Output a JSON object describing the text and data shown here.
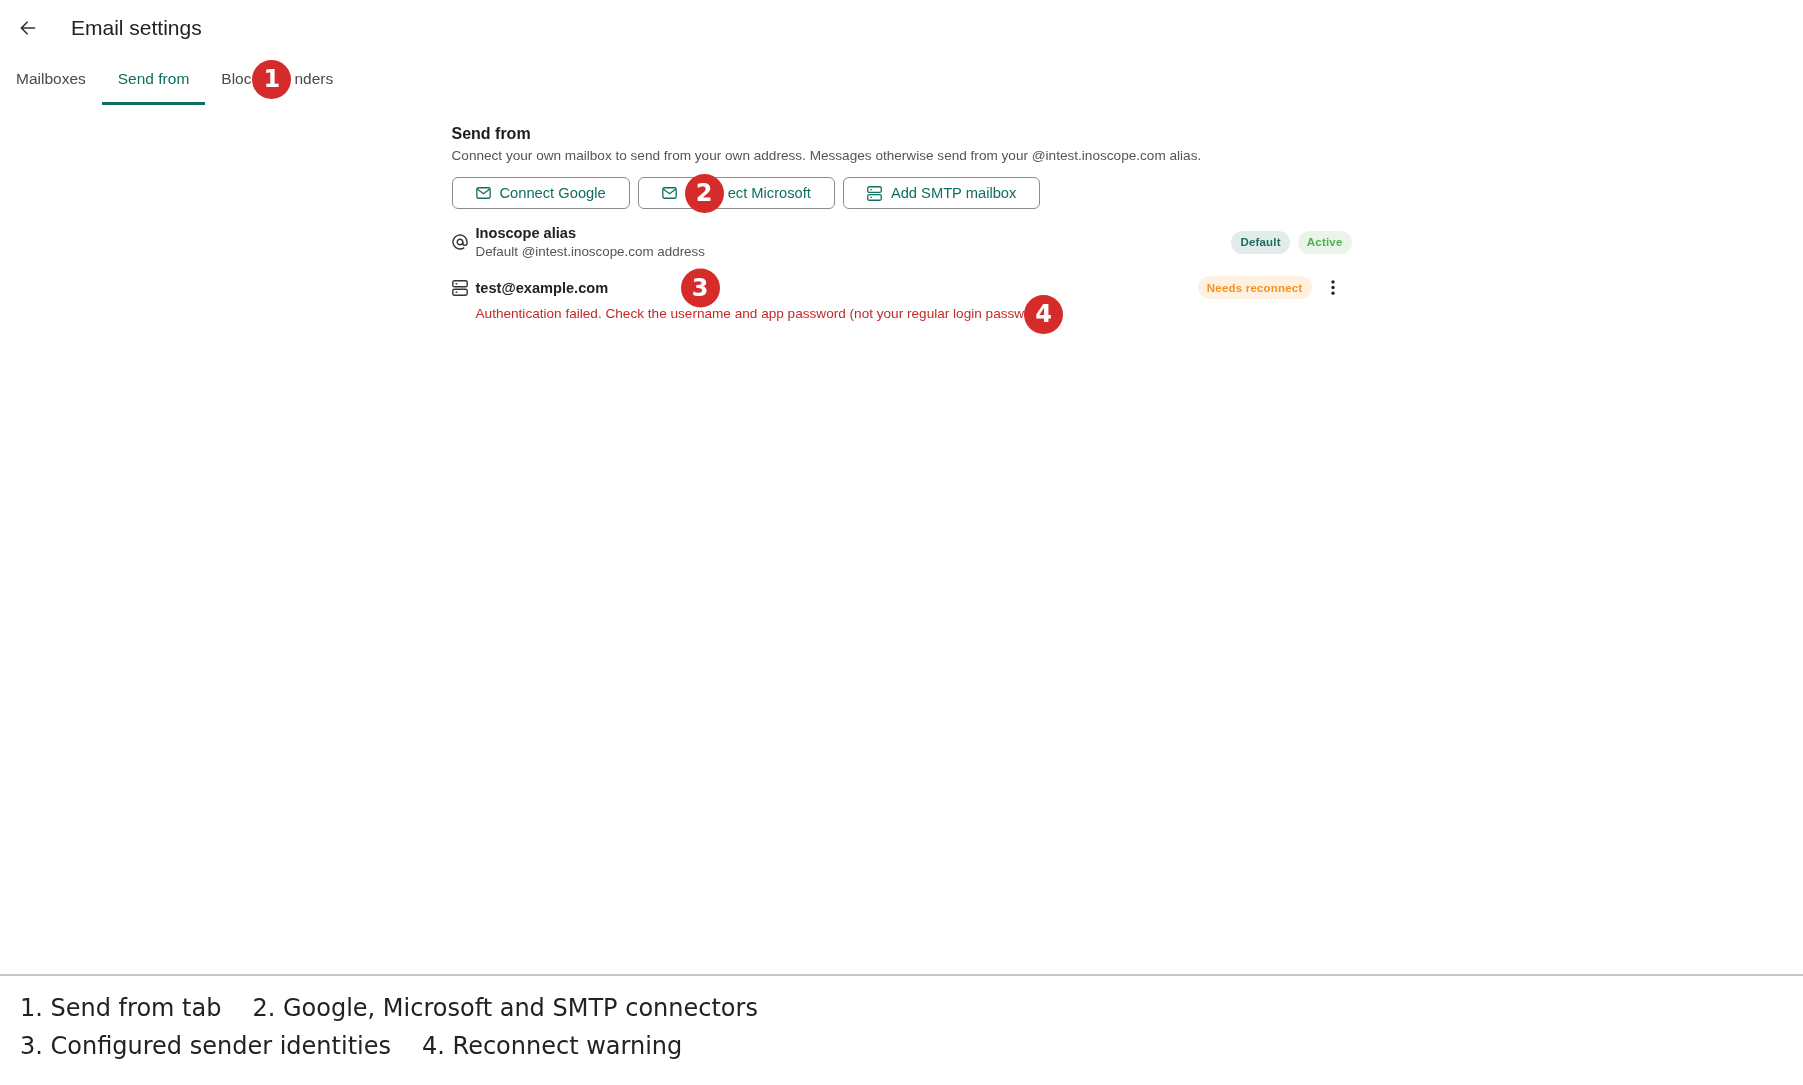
{
  "header": {
    "title": "Email settings"
  },
  "tabs": [
    {
      "label": "Mailboxes",
      "selected": false
    },
    {
      "label": "Send from",
      "selected": true
    },
    {
      "label": "Bloc",
      "marker": "1",
      "label_after": "nders",
      "selected": false
    }
  ],
  "section": {
    "heading": "Send from",
    "description": "Connect your own mailbox to send from your own address. Messages otherwise send from your @intest.inoscope.com alias.",
    "buttons": [
      {
        "label": "Connect Google"
      },
      {
        "marker": "2",
        "label": "ect Microsoft"
      },
      {
        "label": "Add SMTP mailbox"
      }
    ],
    "senders": [
      {
        "name": "Inoscope alias",
        "description": "Default @intest.inoscope.com address",
        "badges": [
          {
            "label": "Default",
            "color": "#1e6b5c"
          },
          {
            "label": "Active",
            "color": "#4caf50"
          }
        ]
      },
      {
        "name": "test@example.com",
        "marker": "3",
        "badges": [
          {
            "label": "Needs reconnect",
            "color": "#f5921b"
          }
        ],
        "menu": true,
        "error": {
          "text": "Authentication failed. Check the username and app password (not your regular login passw",
          "marker": "4"
        }
      }
    ]
  },
  "caption": {
    "lines": [
      [
        "1. Send from tab",
        "2. Google, Microsoft and SMTP connectors"
      ],
      [
        "3. Configured sender identities",
        "4. Reconnect warning"
      ]
    ]
  }
}
